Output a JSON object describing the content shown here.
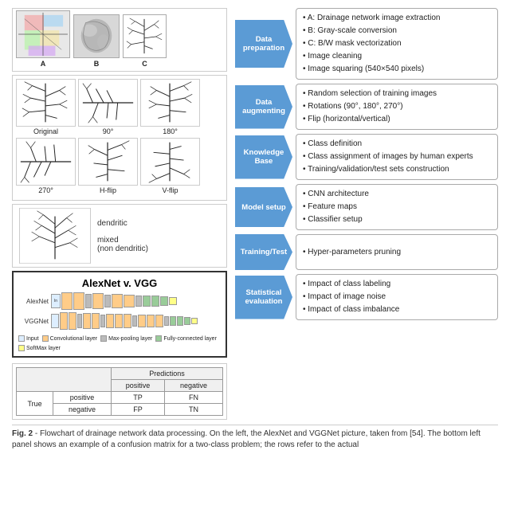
{
  "figure": {
    "title": "Fig. 2",
    "caption_bold": "Fig. 2",
    "caption_text": " - Flowchart of drainage network data processing. On the left, the AlexNet and VGGNet picture, taken from [54]. The bottom left panel shows an example of a confusion matrix for a two-class problem; the rows refer to the actual"
  },
  "left": {
    "image_labels": [
      "A",
      "B",
      "C"
    ],
    "rotation_labels": [
      "Original",
      "90°",
      "180°",
      "270°",
      "H-flip",
      "V-flip"
    ],
    "dendritic_labels": [
      "dendritic",
      "mixed\n(non dendritic)"
    ],
    "alexnet_title": "AlexNet v. VGG",
    "net_rows": [
      {
        "name": "AlexNet",
        "blocks": [
          "blue",
          "blue",
          "blue",
          "orange",
          "orange",
          "green",
          "green",
          "yellow",
          "red"
        ]
      },
      {
        "name": "VGGNet",
        "blocks": [
          "blue",
          "blue",
          "blue",
          "blue",
          "orange",
          "orange",
          "orange",
          "orange",
          "green",
          "green",
          "green",
          "green",
          "yellow",
          "yellow",
          "yellow",
          "red"
        ]
      }
    ],
    "legend": [
      {
        "color": "blue",
        "label": "Input"
      },
      {
        "color": "orange",
        "label": "Convolutional layer"
      },
      {
        "color": "gray",
        "label": "Max-pooling layer"
      },
      {
        "color": "green",
        "label": "Fully-connected layer"
      },
      {
        "color": "yellow",
        "label": "SoftMax layer"
      }
    ],
    "confusion": {
      "header1": "Predictions",
      "col1": "positive",
      "col2": "negative",
      "row1_label": "positive",
      "row2_label": "negative",
      "tp": "TP",
      "fn": "FN",
      "fp": "FP",
      "tn": "TN",
      "true_label": "True"
    }
  },
  "steps": [
    {
      "id": "data-preparation",
      "arrow_label": "Data preparation",
      "bullets": [
        "A: Drainage network image extraction",
        "B: Gray-scale conversion",
        "C: B/W mask vectorization",
        "Image cleaning",
        "Image squaring (540×540 pixels)"
      ]
    },
    {
      "id": "data-augmenting",
      "arrow_label": "Data augmenting",
      "bullets": [
        "Random selection of training images",
        "Rotations (90°, 180°, 270°)",
        "Flip (horizontal/vertical)"
      ]
    },
    {
      "id": "knowledge-base",
      "arrow_label": "Knowledge Base",
      "bullets": [
        "Class definition",
        "Class assignment of images by human experts",
        "Training/validation/test sets construction"
      ]
    },
    {
      "id": "model-setup",
      "arrow_label": "Model setup",
      "bullets": [
        "CNN architecture",
        "Feature maps",
        "Classifier setup"
      ]
    },
    {
      "id": "training-test",
      "arrow_label": "Training/Test",
      "bullets": [
        "Hyper-parameters pruning"
      ]
    },
    {
      "id": "statistical-evaluation",
      "arrow_label": "Statistical evaluation",
      "bullets": [
        "Impact of class labeling",
        "Impact of image noise",
        "Impact of class imbalance"
      ]
    }
  ]
}
